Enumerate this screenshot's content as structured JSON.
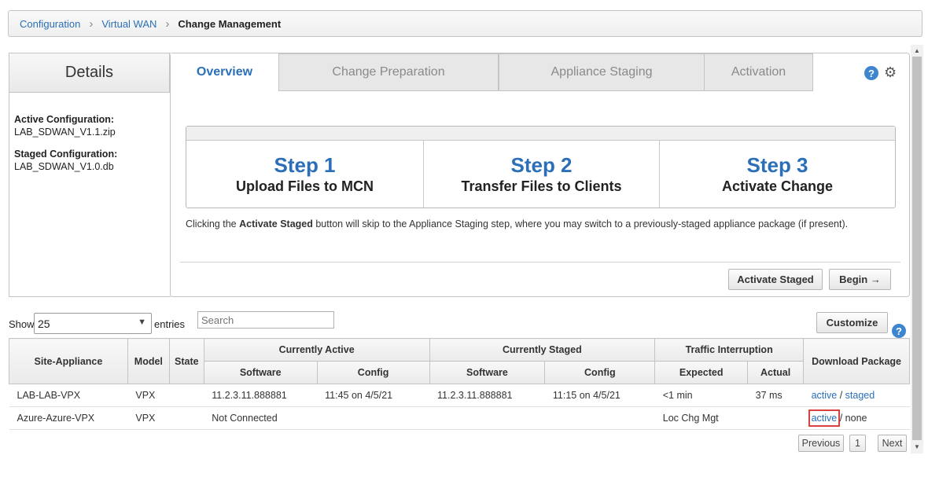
{
  "breadcrumb": {
    "items": [
      "Configuration",
      "Virtual WAN"
    ],
    "current": "Change Management"
  },
  "details": {
    "title": "Details",
    "active_label": "Active Configuration:",
    "active_value": "LAB_SDWAN_V1.1.zip",
    "staged_label": "Staged Configuration:",
    "staged_value": "LAB_SDWAN_V1.0.db"
  },
  "tabs": [
    "Overview",
    "Change Preparation",
    "Appliance Staging",
    "Activation"
  ],
  "help_icon_glyph": "?",
  "steps": [
    {
      "num": "Step 1",
      "desc": "Upload Files to MCN"
    },
    {
      "num": "Step 2",
      "desc": "Transfer Files to Clients"
    },
    {
      "num": "Step 3",
      "desc": "Activate Change"
    }
  ],
  "info": {
    "prefix": "Clicking the ",
    "bold": "Activate Staged",
    "suffix": " button will skip to the Appliance Staging step, where you may switch to a previously-staged appliance package (if present)."
  },
  "buttons": {
    "activate_staged": "Activate Staged",
    "begin": "Begin →",
    "customize": "Customize"
  },
  "table_controls": {
    "show_label": "Show",
    "page_size": "25",
    "entries_label": "entries",
    "search_placeholder": "Search"
  },
  "table": {
    "headers": {
      "site_appliance": "Site-Appliance",
      "model": "Model",
      "state": "State",
      "currently_active": "Currently Active",
      "currently_staged": "Currently Staged",
      "traffic_interruption": "Traffic Interruption",
      "download_package": "Download Package",
      "software": "Software",
      "config": "Config",
      "expected": "Expected",
      "actual": "Actual"
    },
    "rows": [
      {
        "site": "LAB-LAB-VPX",
        "model": "VPX",
        "state": "",
        "active_software": "11.2.3.11.888881",
        "active_config": "11:45 on 4/5/21",
        "staged_software": "11.2.3.11.888881",
        "staged_config": "11:15 on 4/5/21",
        "expected": "<1 min",
        "actual": "37 ms",
        "download_active": "active",
        "download_sep": "/",
        "download_other": "staged"
      },
      {
        "site": "Azure-Azure-VPX",
        "model": "VPX",
        "state": "",
        "active_software": "Not Connected",
        "active_config": "",
        "staged_software": "",
        "staged_config": "",
        "expected": "Loc Chg Mgt",
        "actual": "",
        "download_active": "active",
        "download_sep": "/",
        "download_other": "none"
      }
    ]
  },
  "pagination": {
    "previous": "Previous",
    "page": "1",
    "next": "Next"
  },
  "colors": {
    "accent_blue": "#2a6fb8",
    "highlight_red": "#d94040"
  }
}
